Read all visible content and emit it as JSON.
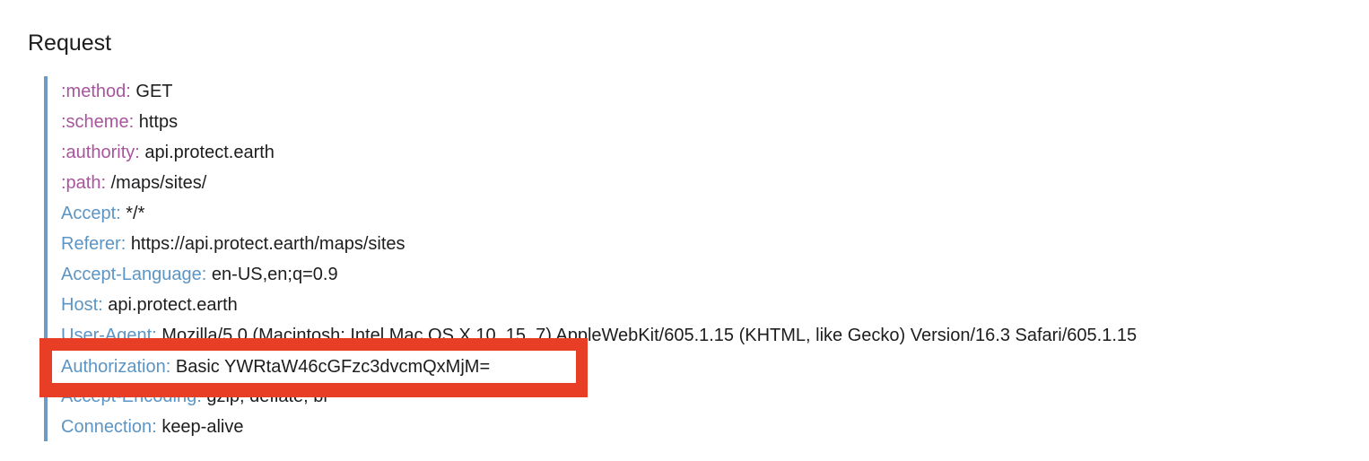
{
  "section": {
    "title": "Request"
  },
  "headers": [
    {
      "name": "method",
      "value": "GET",
      "kind": "pseudo"
    },
    {
      "name": "scheme",
      "value": "https",
      "kind": "pseudo"
    },
    {
      "name": "authority",
      "value": "api.protect.earth",
      "kind": "pseudo"
    },
    {
      "name": "path",
      "value": "/maps/sites/",
      "kind": "pseudo"
    },
    {
      "name": "Accept",
      "value": "*/*",
      "kind": "regular"
    },
    {
      "name": "Referer",
      "value": "https://api.protect.earth/maps/sites",
      "kind": "regular"
    },
    {
      "name": "Accept-Language",
      "value": "en-US,en;q=0.9",
      "kind": "regular"
    },
    {
      "name": "Host",
      "value": "api.protect.earth",
      "kind": "regular"
    },
    {
      "name": "User-Agent",
      "value": "Mozilla/5.0 (Macintosh; Intel Mac OS X 10_15_7) AppleWebKit/605.1.15 (KHTML, like Gecko) Version/16.3 Safari/605.1.15",
      "kind": "regular"
    },
    {
      "name": "Authorization",
      "value": "Basic YWRtaW46cGFzc3dvcmQxMjM=",
      "kind": "regular"
    },
    {
      "name": "Accept-Encoding",
      "value": "gzip, deflate, br",
      "kind": "regular"
    },
    {
      "name": "Connection",
      "value": "keep-alive",
      "kind": "regular"
    }
  ],
  "highlight": {
    "name": "Authorization",
    "value": "Basic YWRtaW46cGFzc3dvcmQxMjM=",
    "color": "#e83e25"
  },
  "colors": {
    "pseudo_header": "#a8559d",
    "regular_header": "#5c95c4",
    "border": "#6e9ac6",
    "text": "#1d1d1f"
  }
}
